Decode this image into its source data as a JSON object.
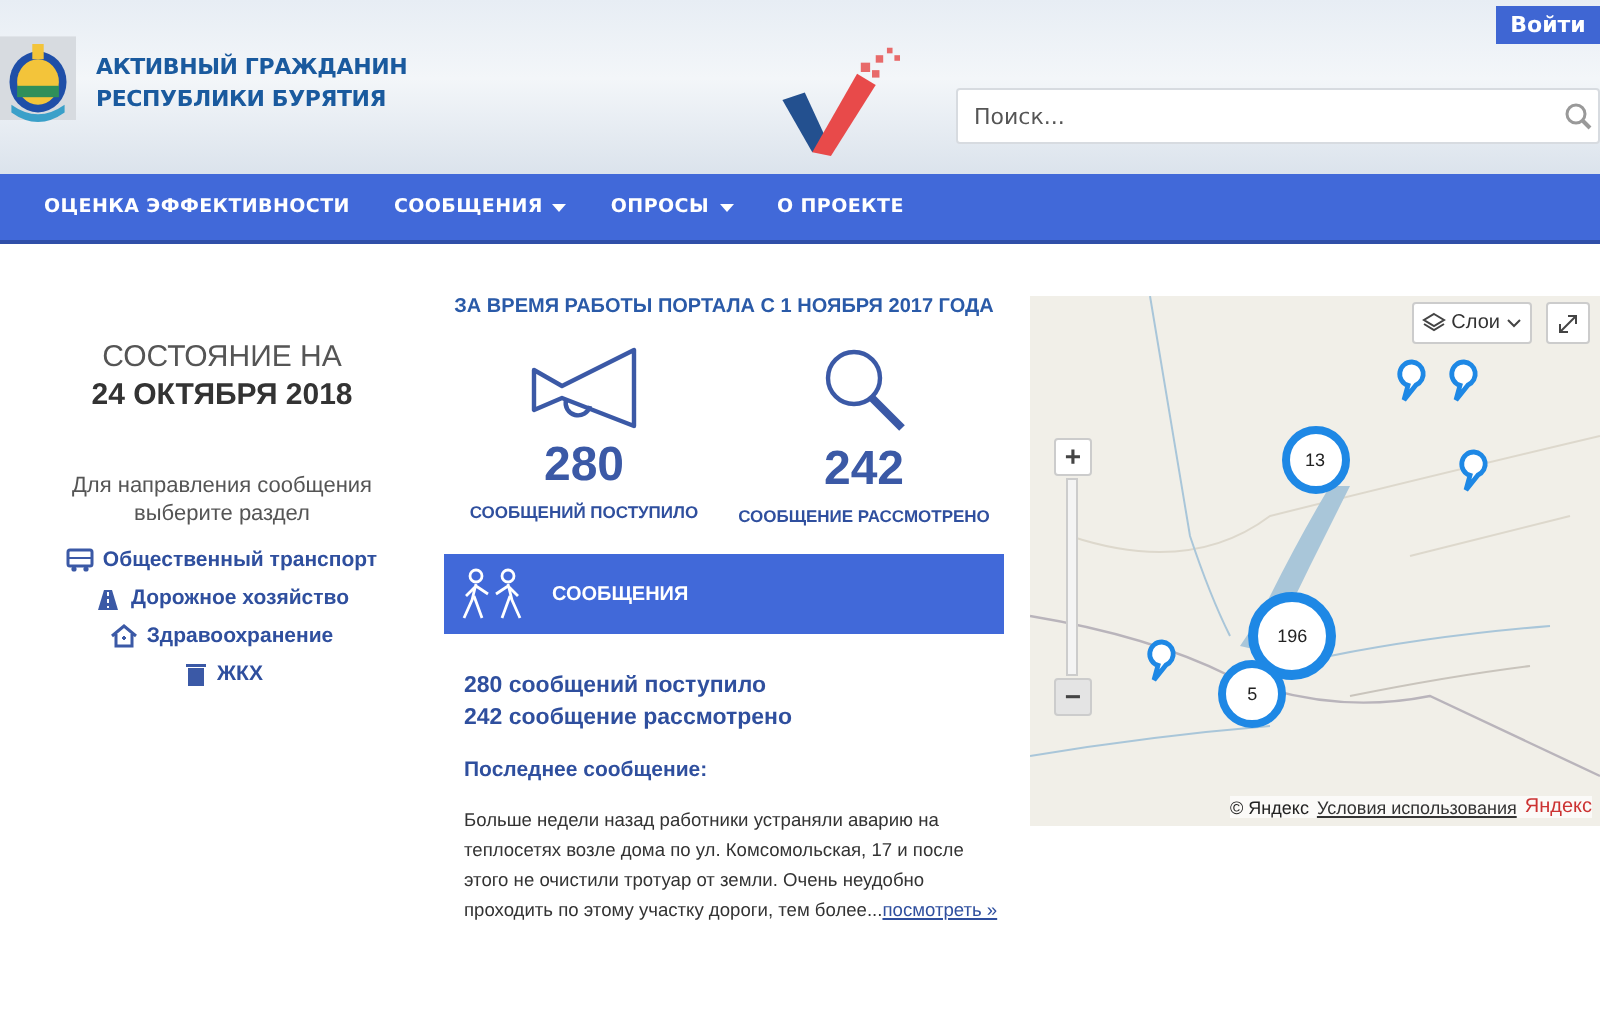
{
  "header": {
    "title_lines": [
      "АКТИВНЫЙ ГРАЖДАНИН",
      "РЕСПУБЛИКИ БУРЯТИЯ"
    ],
    "login_button": "Войти",
    "search": {
      "placeholder": "Поиск..."
    }
  },
  "nav": [
    {
      "label": "ОЦЕНКА ЭФФЕКТИВНОСТИ",
      "dropdown": false
    },
    {
      "label": "СООБЩЕНИЯ",
      "dropdown": true
    },
    {
      "label": "ОПРОСЫ",
      "dropdown": true
    },
    {
      "label": "О ПРОЕКТЕ",
      "dropdown": false
    }
  ],
  "status": {
    "heading": "СОСТОЯНИЕ НА",
    "date": "24 ОКТЯБРЯ 2018",
    "hint": "Для направления сообщения выберите раздел",
    "sections": [
      {
        "label": "Общественный транспорт",
        "kind": "bus"
      },
      {
        "label": "Дорожное хозяйство",
        "kind": "road"
      },
      {
        "label": "Здравоохранение",
        "kind": "health"
      },
      {
        "label": "ЖКХ",
        "kind": "housing"
      }
    ]
  },
  "stats": {
    "title": "ЗА ВРЕМЯ РАБОТЫ ПОРТАЛА С 1 НОЯБРЯ 2017 ГОДА",
    "items": [
      {
        "kind": "megaphone",
        "number": "280",
        "label": "СООБЩЕНИЙ ПОСТУПИЛО"
      },
      {
        "kind": "magnifier",
        "number": "242",
        "label": "СООБЩЕНИЕ РАССМОТРЕНО"
      }
    ]
  },
  "messages": {
    "title": "СООБЩЕНИЯ",
    "summary": [
      "280 сообщений поступило",
      "242 сообщение рассмотрено"
    ],
    "last_label": "Последнее сообщение:",
    "last_text": "Больше недели назад работники устраняли аварию на теплосетях возле дома по ул. Комсомольская, 17 и после этого не очистили тротуар от земли. Очень неудобно проходить по этому участку дороги, тем более...",
    "more_link": "посмотреть »"
  },
  "map": {
    "layers_button": "Слои",
    "zoom_in": "+",
    "zoom_out": "−",
    "markers": [
      {
        "kind": "cluster",
        "count": "13"
      },
      {
        "kind": "cluster",
        "count": "196"
      },
      {
        "kind": "cluster",
        "count": "5"
      },
      {
        "kind": "pin"
      },
      {
        "kind": "pin"
      },
      {
        "kind": "pin"
      },
      {
        "kind": "pin"
      }
    ],
    "copyright": "© Яндекс",
    "terms_link": "Условия использования",
    "logo": "Яндекс"
  }
}
